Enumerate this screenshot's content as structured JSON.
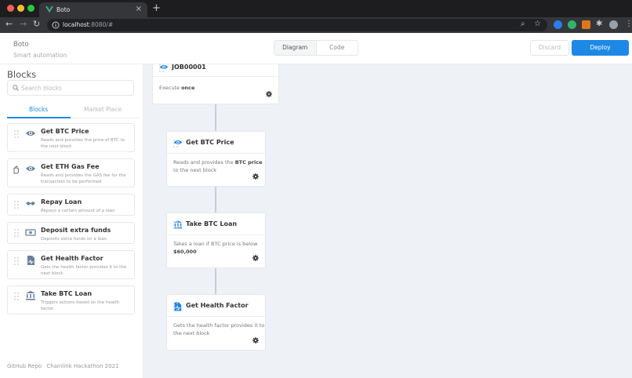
{
  "browser": {
    "tab_title": "Boto",
    "url_host": "localhost",
    "url_rest": ":8080/#"
  },
  "header": {
    "app_name": "Boto",
    "app_subtitle": "Smart automation",
    "view_tabs": [
      "Diagram",
      "Code"
    ],
    "discard_label": "Discard",
    "deploy_label": "Deploy"
  },
  "sidebar": {
    "title": "Blocks",
    "search_placeholder": "Search blocks",
    "tabs": [
      "Blocks",
      "Market Place"
    ],
    "blocks": [
      {
        "name": "Get BTC Price",
        "desc": "Reads and provides the price of BTC to the next block",
        "icon": "eye-icon"
      },
      {
        "name": "Get ETH Gas Fee",
        "desc": "Reads and provides the GAS fee for the transaction to be performed",
        "icon": "eye-icon"
      },
      {
        "name": "Repay Loan",
        "desc": "Repays a certain amount of a loan",
        "icon": "handshake-icon"
      },
      {
        "name": "Deposit extra funds",
        "desc": "Deposits extra funds on a loan",
        "icon": "money-icon"
      },
      {
        "name": "Get Health Factor",
        "desc": "Gets the health factor provides it to the next block",
        "icon": "health-doc-icon"
      },
      {
        "name": "Take BTC Loan",
        "desc": "Triggers actions based on the health factor",
        "icon": "bank-icon"
      }
    ],
    "footer_links": [
      "GitHub Repo",
      "Chainlink Hackathon 2021"
    ]
  },
  "canvas": {
    "job": {
      "name": "JOB00001",
      "exec_prefix": "Execute",
      "exec_value": "once"
    },
    "nodes": [
      {
        "name": "Get BTC Price",
        "body_1": "Reads and provides the",
        "body_bold": "BTC price",
        "body_2": "to the next block",
        "icon": "eye-icon"
      },
      {
        "name": "Take BTC Loan",
        "body_1": "Takes a loan if BTC price is below",
        "body_bold": "$60,000",
        "body_2": "",
        "icon": "bank-icon"
      },
      {
        "name": "Get Health Factor",
        "body_1": "Gets the health factor provides it to the next block",
        "body_bold": "",
        "body_2": "",
        "icon": "health-doc-icon"
      }
    ]
  },
  "colors": {
    "accent": "#1e88e5",
    "canvas_bg": "#eef1f5"
  }
}
